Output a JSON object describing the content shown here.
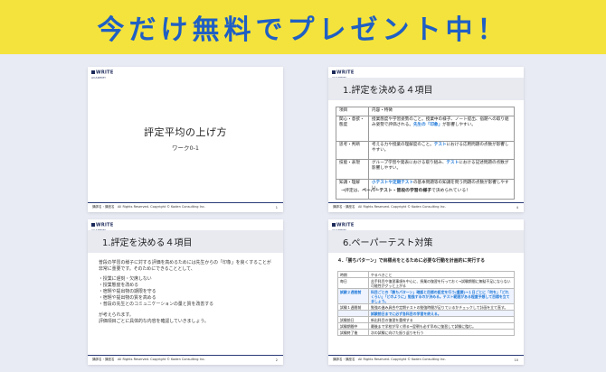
{
  "banner": {
    "text": "今だけ無料でプレゼント中！"
  },
  "logo": {
    "text": "WRITE",
    "sub": "ACADEMY"
  },
  "footer": {
    "text": "講師名・講座名　All Rights Reserved. Copyright © Koden Consulting Inc.",
    "pages": [
      "1",
      "4",
      "2",
      "10"
    ]
  },
  "slide1": {
    "title": "評定平均の上げ方",
    "subtitle": "ワーク0-1"
  },
  "slide2": {
    "heading": "1.評定を決める４項目",
    "table": [
      {
        "k": "項目",
        "v": "内容・特徴"
      },
      {
        "k": "関心・意欲・態度",
        "v": "授業態度や学習姿勢のこと。授業中の様子、ノート提出、宿題への取り組み姿勢で評価される。",
        "v_b": "先生の「印象」",
        "v_c": "が影響しやすい。"
      },
      {
        "k": "思考・判断",
        "v": "考える力や授業の理解度のこと。",
        "v_b": "テスト",
        "v_c": "における応用問題の点数が影響しやすい。"
      },
      {
        "k": "技能・表現",
        "v": "グループ学習や発表における取り組み、",
        "v_b": "テスト",
        "v_c": "における記述問題の点数が影響しやすい。"
      },
      {
        "k": "知識・理解",
        "v": "",
        "v_b": "小テストや定期テスト",
        "v_c": "の基本問題等の知識を問う問題の点数が影響しやすい。"
      }
    ],
    "conclusion_a": "→評定は、",
    "conclusion_b": "ペーパーテスト・普段の学習の様子",
    "conclusion_c": "で決められている！"
  },
  "slide3": {
    "heading": "1.評定を決める４項目",
    "intro": "普段の学習の様子に対する評価を高めるためには先生からの「印象」を良くすることが非常に重要です。そのためにできることとして、",
    "bullets": [
      "・授業に遅刻・欠席しない",
      "・授業態度を改める",
      "・宿題や提出物の期限を守る",
      "・宿題や提出物の質を高める",
      "・普段の先生とのコミュニケーションの量と質を改善する"
    ],
    "outro1": "が考えられます。",
    "outro2": "評価項目ごとに具体的な内容を確認していきましょう。"
  },
  "slide4": {
    "heading": "6.ペーパーテスト対策",
    "subheading": "４.「勝ちパターン」で目標点をとるために必要な行動を計画的に実行する",
    "rows": [
      {
        "k": "時期",
        "v": "やるべきこと",
        "hl": false
      },
      {
        "k": "毎日",
        "v": "苦手科目や復習事項を中心に、授業の復習を行っておく→試験期間に無駄不足にならない可能性がグッと上がる",
        "hl": false
      },
      {
        "k": "試験２週間前",
        "v": "科目ごとの「勝ちパターン」確認と目標の設定を行う(重要)→１日ごとに「何を」「どれくらい」「どのように」勉強するのか決める。テスト範囲がある程度予想して目標を立てましょう。",
        "hl": true
      },
      {
        "k": "試験１週間前",
        "v": "勉強の進み具合や定期テストの勉強時間が足りているかチェックして計画を立て直す。",
        "hl": false
      },
      {
        "k": "",
        "v": "試験前日までに必ず各科目の学習を終える。",
        "hl": true
      },
      {
        "k": "試験前日",
        "v": "新出科目の復習を重視する",
        "hl": false
      },
      {
        "k": "試験期間中",
        "v": "最後まで学校が早く帰る→翌朝も必ず早めに復習して試験に臨む。",
        "hl": false
      },
      {
        "k": "試験終了後",
        "v": "次の試験に向けた振り返りを行う",
        "hl": false
      }
    ]
  }
}
